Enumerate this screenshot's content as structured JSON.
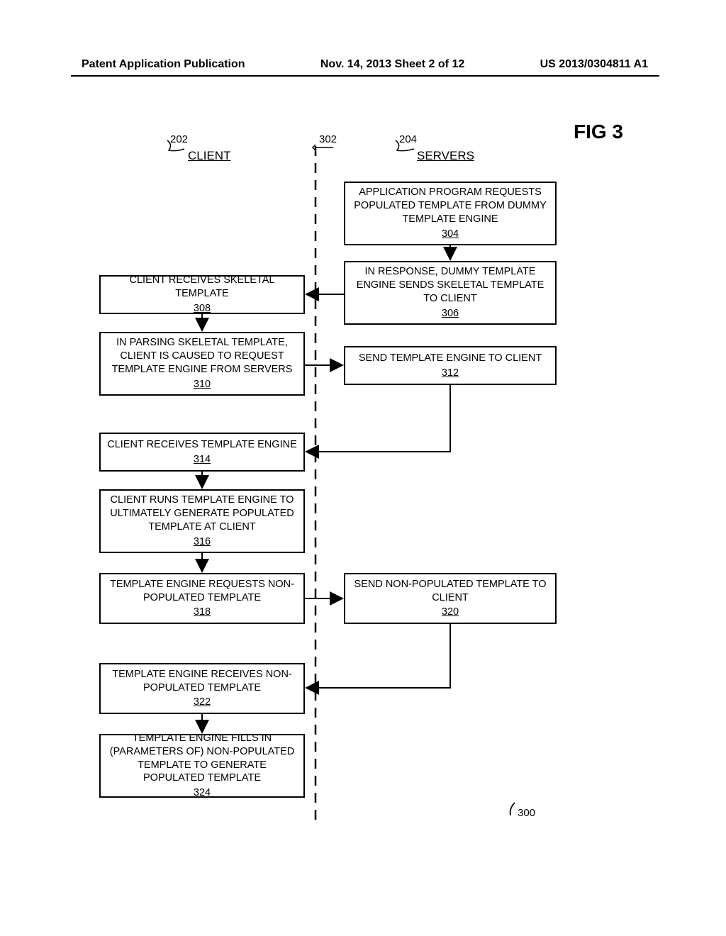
{
  "header": {
    "left": "Patent Application Publication",
    "center": "Nov. 14, 2013  Sheet 2 of 12",
    "right": "US 2013/0304811 A1"
  },
  "figure": {
    "title": "FIG 3",
    "clientLabel": "CLIENT",
    "serversLabel": "SERVERS",
    "clientRef": "202",
    "serversRef": "204",
    "dividerRef": "302",
    "overallRef": "300",
    "boxes": {
      "b304": {
        "text": "APPLICATION PROGRAM REQUESTS POPULATED TEMPLATE FROM DUMMY TEMPLATE ENGINE",
        "num": "304"
      },
      "b306": {
        "text": "IN RESPONSE, DUMMY TEMPLATE ENGINE SENDS SKELETAL TEMPLATE TO CLIENT",
        "num": "306"
      },
      "b308": {
        "text": "CLIENT RECEIVES SKELETAL TEMPLATE",
        "num": "308"
      },
      "b310": {
        "text": "IN PARSING SKELETAL TEMPLATE, CLIENT IS CAUSED TO REQUEST TEMPLATE ENGINE FROM SERVERS",
        "num": "310"
      },
      "b312": {
        "text": "SEND TEMPLATE ENGINE TO CLIENT",
        "num": "312"
      },
      "b314": {
        "text": "CLIENT RECEIVES TEMPLATE ENGINE",
        "num": "314"
      },
      "b316": {
        "text": "CLIENT RUNS TEMPLATE ENGINE TO ULTIMATELY GENERATE POPULATED TEMPLATE AT CLIENT",
        "num": "316"
      },
      "b318": {
        "text": "TEMPLATE ENGINE REQUESTS NON-POPULATED TEMPLATE",
        "num": "318"
      },
      "b320": {
        "text": "SEND NON-POPULATED TEMPLATE TO CLIENT",
        "num": "320"
      },
      "b322": {
        "text": "TEMPLATE ENGINE RECEIVES NON-POPULATED TEMPLATE",
        "num": "322"
      },
      "b324": {
        "text": "TEMPLATE ENGINE FILLS IN (PARAMETERS OF) NON-POPULATED TEMPLATE TO GENERATE POPULATED TEMPLATE",
        "num": "324"
      }
    }
  }
}
